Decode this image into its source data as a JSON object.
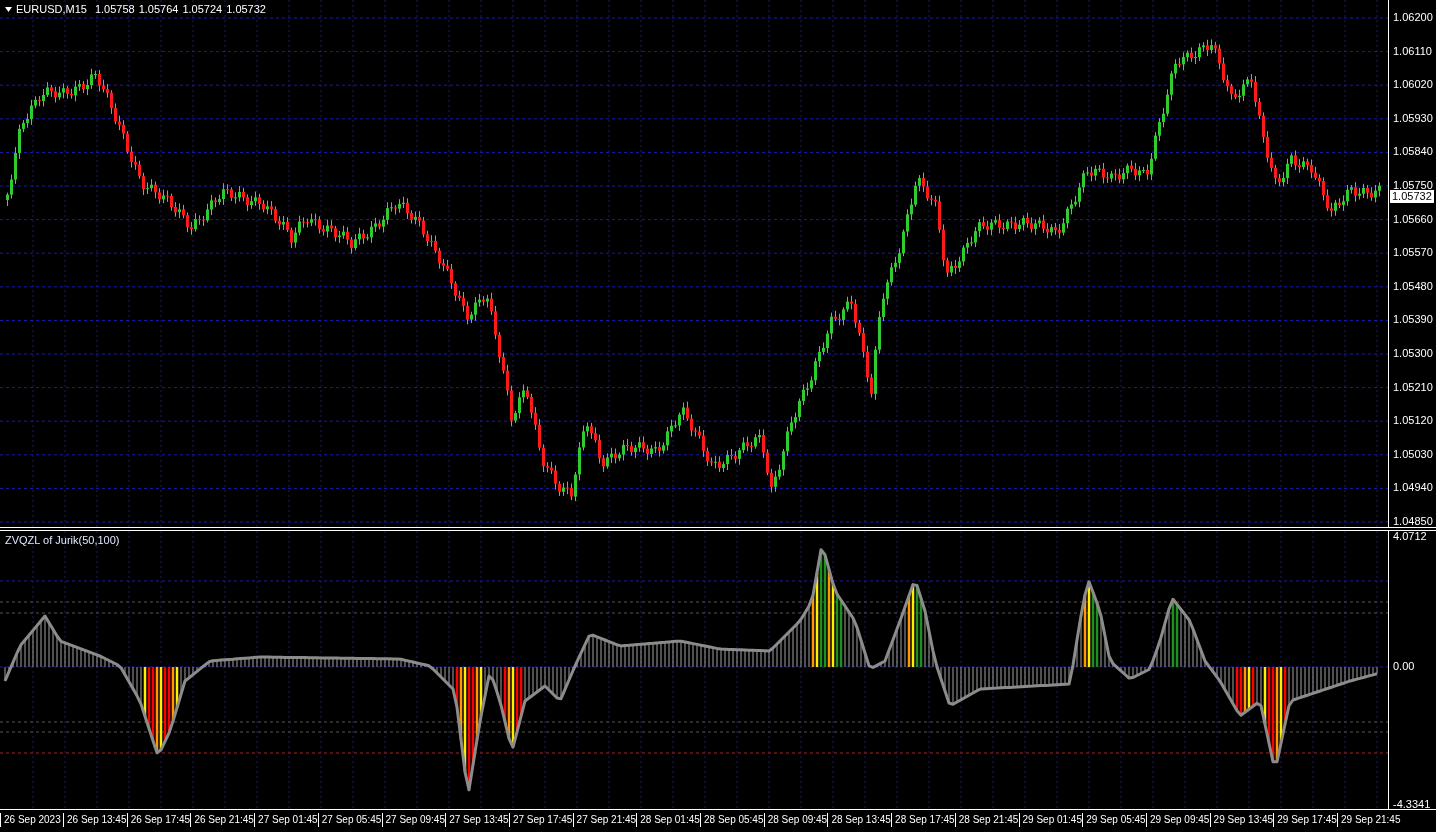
{
  "chart": {
    "symbol": "EURUSD,M15",
    "quotes": [
      "1.05758",
      "1.05764",
      "1.05724",
      "1.05732"
    ],
    "price_axis": [
      "1.06200",
      "1.06110",
      "1.06020",
      "1.05930",
      "1.05840",
      "1.05750",
      "1.05660",
      "1.05570",
      "1.05480",
      "1.05390",
      "1.05300",
      "1.05210",
      "1.05120",
      "1.05030",
      "1.04940",
      "1.04850"
    ],
    "current_price": "1.05732"
  },
  "indicator": {
    "title": "ZVQZL of Jurik(50,100)",
    "axis": [
      "4.0712",
      "0.00",
      "-4.3341"
    ]
  },
  "time_axis": [
    "26 Sep 2023",
    "26 Sep 13:45",
    "26 Sep 17:45",
    "26 Sep 21:45",
    "27 Sep 01:45",
    "27 Sep 05:45",
    "27 Sep 09:45",
    "27 Sep 13:45",
    "27 Sep 17:45",
    "27 Sep 21:45",
    "28 Sep 01:45",
    "28 Sep 05:45",
    "28 Sep 09:45",
    "28 Sep 13:45",
    "28 Sep 17:45",
    "28 Sep 21:45",
    "29 Sep 01:45",
    "29 Sep 05:45",
    "29 Sep 09:45",
    "29 Sep 13:45",
    "29 Sep 17:45",
    "29 Sep 21:45"
  ]
}
